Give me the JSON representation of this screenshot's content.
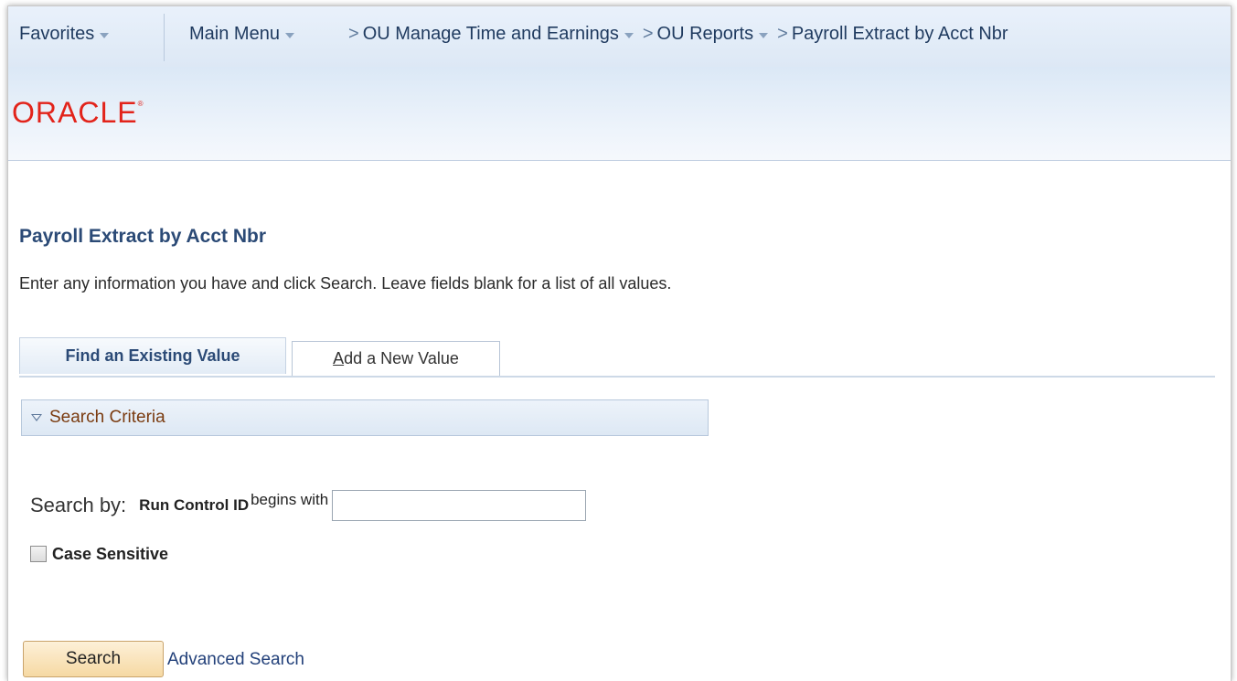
{
  "nav": {
    "favorites": "Favorites",
    "main_menu": "Main Menu",
    "breadcrumbs": [
      {
        "label": "OU Manage Time and Earnings"
      },
      {
        "label": "OU Reports"
      },
      {
        "label": "Payroll Extract by Acct Nbr"
      }
    ],
    "chevron_glyph": ">"
  },
  "banner": {
    "logo_text": "ORACLE",
    "logo_mark": "®",
    "logo_color": "#e2231a"
  },
  "page": {
    "title": "Payroll Extract by Acct Nbr",
    "instructions": "Enter any information you have and click Search. Leave fields blank for a list of all values."
  },
  "tabs": [
    {
      "label": "Find an Existing Value",
      "active": true
    },
    {
      "label_accesskey": "A",
      "label_rest": "dd a New Value",
      "active": false
    }
  ],
  "search_criteria": {
    "header": "Search Criteria",
    "search_by_label": "Search by:",
    "field_label": "Run Control ID",
    "operator_label": "begins with",
    "input_value": "",
    "case_sensitive_label": "Case Sensitive",
    "case_sensitive_checked": false
  },
  "actions": {
    "search_button": "Search",
    "advanced_search_link": "Advanced Search"
  }
}
